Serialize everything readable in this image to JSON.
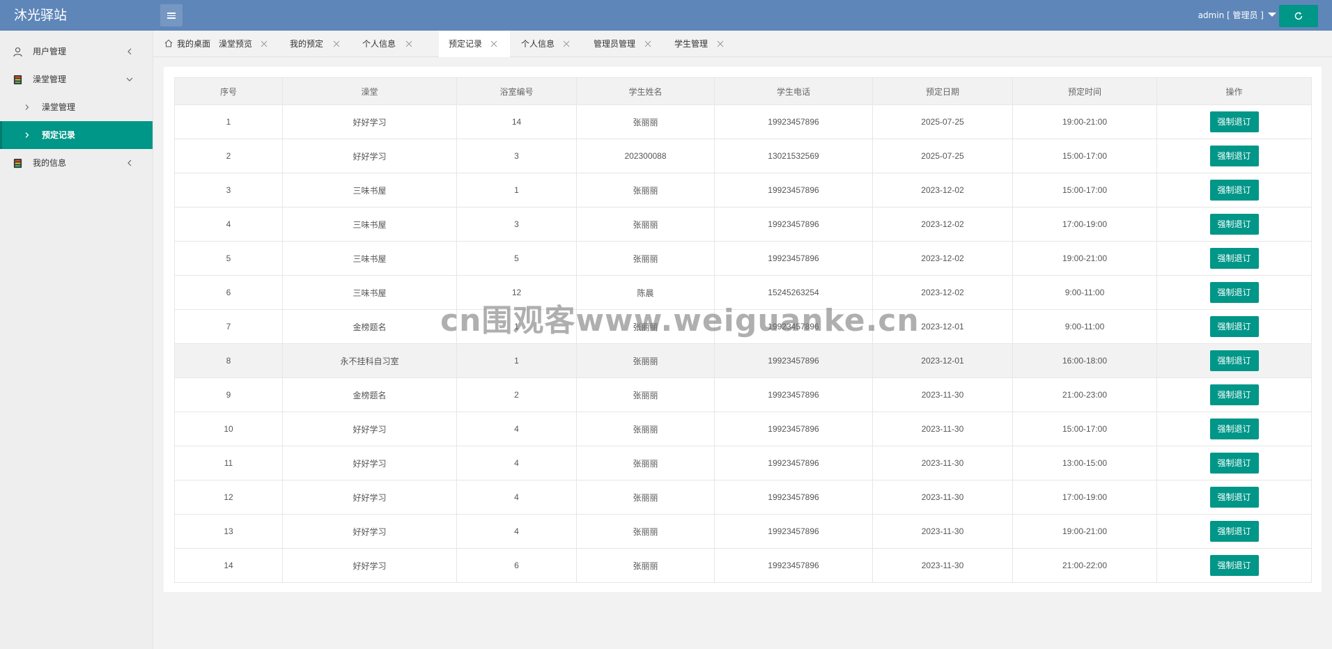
{
  "app": {
    "title": "沐光驿站"
  },
  "header": {
    "user": "admin [ 管理员 ]"
  },
  "sidebar": {
    "items": [
      {
        "label": "用户管理"
      },
      {
        "label": "澡堂管理"
      },
      {
        "label": "澡堂管理"
      },
      {
        "label": "预定记录"
      },
      {
        "label": "我的信息"
      }
    ]
  },
  "tabs": [
    {
      "label": "我的桌面"
    },
    {
      "label": "澡堂预览"
    },
    {
      "label": "我的预定"
    },
    {
      "label": "个人信息"
    },
    {
      "label": "预定记录"
    },
    {
      "label": "个人信息"
    },
    {
      "label": "管理员管理"
    },
    {
      "label": "学生管理"
    }
  ],
  "table": {
    "headers": [
      "序号",
      "澡堂",
      "浴室编号",
      "学生姓名",
      "学生电话",
      "预定日期",
      "预定时间",
      "操作"
    ],
    "action_label": "强制退订",
    "rows": [
      [
        "1",
        "好好学习",
        "14",
        "张丽丽",
        "19923457896",
        "2025-07-25",
        "19:00-21:00"
      ],
      [
        "2",
        "好好学习",
        "3",
        "202300088",
        "13021532569",
        "2025-07-25",
        "15:00-17:00"
      ],
      [
        "3",
        "三味书屋",
        "1",
        "张丽丽",
        "19923457896",
        "2023-12-02",
        "15:00-17:00"
      ],
      [
        "4",
        "三味书屋",
        "3",
        "张丽丽",
        "19923457896",
        "2023-12-02",
        "17:00-19:00"
      ],
      [
        "5",
        "三味书屋",
        "5",
        "张丽丽",
        "19923457896",
        "2023-12-02",
        "19:00-21:00"
      ],
      [
        "6",
        "三味书屋",
        "12",
        "陈晨",
        "15245263254",
        "2023-12-02",
        "9:00-11:00"
      ],
      [
        "7",
        "金榜题名",
        "1",
        "张丽丽",
        "19923457896",
        "2023-12-01",
        "9:00-11:00"
      ],
      [
        "8",
        "永不挂科自习室",
        "1",
        "张丽丽",
        "19923457896",
        "2023-12-01",
        "16:00-18:00"
      ],
      [
        "9",
        "金榜题名",
        "2",
        "张丽丽",
        "19923457896",
        "2023-11-30",
        "21:00-23:00"
      ],
      [
        "10",
        "好好学习",
        "4",
        "张丽丽",
        "19923457896",
        "2023-11-30",
        "15:00-17:00"
      ],
      [
        "11",
        "好好学习",
        "4",
        "张丽丽",
        "19923457896",
        "2023-11-30",
        "13:00-15:00"
      ],
      [
        "12",
        "好好学习",
        "4",
        "张丽丽",
        "19923457896",
        "2023-11-30",
        "17:00-19:00"
      ],
      [
        "13",
        "好好学习",
        "4",
        "张丽丽",
        "19923457896",
        "2023-11-30",
        "19:00-21:00"
      ],
      [
        "14",
        "好好学习",
        "6",
        "张丽丽",
        "19923457896",
        "2023-11-30",
        "21:00-22:00"
      ]
    ]
  },
  "watermark": "cn围观客www.weiguanke.cn",
  "colors": {
    "header": "#5f86b8",
    "accent": "#009688"
  }
}
